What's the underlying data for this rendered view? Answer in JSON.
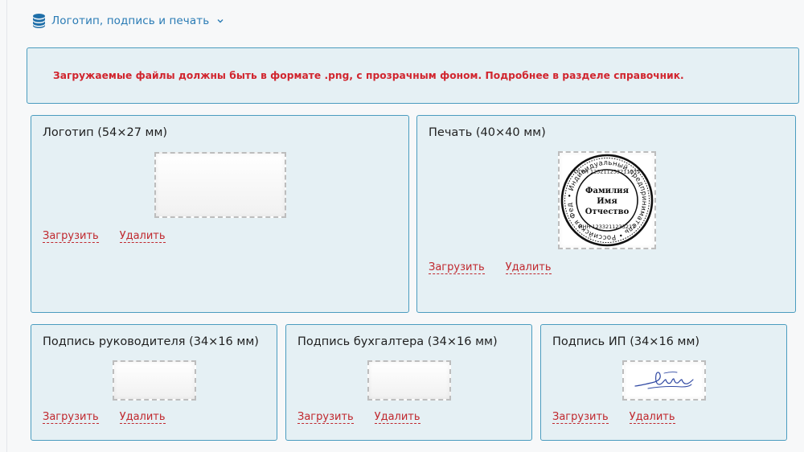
{
  "section": {
    "title": "Логотип, подпись и печать",
    "icon": "database-icon",
    "chevron": "chevron-down-icon"
  },
  "notice": "Загружаемые файлы должны быть в формате .png, с прозрачным фоном. Подробнее в разделе справочник.",
  "actions": {
    "upload": "Загрузить",
    "delete": "Удалить"
  },
  "cards": {
    "logo": {
      "title": "Логотип (54×27 мм)"
    },
    "stamp": {
      "title": "Печать (40×40 мм)",
      "ring_text": "• Индивидуальный предприниматель • Российская Федерация г. Белгород",
      "ogrn": "ОГРН 123211233211233",
      "inn": "ИНН 1233211233211",
      "name_lines": [
        "Фамилия",
        "Имя",
        "Отчество"
      ]
    },
    "head_signature": {
      "title": "Подпись руководителя (34×16 мм)"
    },
    "accountant_signature": {
      "title": "Подпись бухгалтера (34×16 мм)"
    },
    "ip_signature": {
      "title": "Подпись ИП (34×16 мм)"
    }
  },
  "colors": {
    "accent": "#2a7bb5",
    "card_bg": "#e5f0f4",
    "card_border": "#4b9cbf",
    "warning": "#d1252e",
    "link": "#c0272d"
  }
}
